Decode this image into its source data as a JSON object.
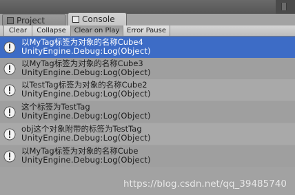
{
  "tabs": [
    {
      "label": "Project",
      "icon": "folder-icon"
    },
    {
      "label": "Console",
      "icon": "console-icon"
    }
  ],
  "toolbar": {
    "clear": "Clear",
    "collapse": "Collapse",
    "clear_on_play": "Clear on Play",
    "error_pause": "Error Pause"
  },
  "log_entries": [
    {
      "line1": "以MyTag标签为对象的名称Cube4",
      "line2": "UnityEngine.Debug:Log(Object)",
      "selected": true
    },
    {
      "line1": "以MyTag标签为对象的名称Cube3",
      "line2": "UnityEngine.Debug:Log(Object)",
      "selected": false
    },
    {
      "line1": "以TestTag标签为对象的名称Cube2",
      "line2": "UnityEngine.Debug:Log(Object)",
      "selected": false
    },
    {
      "line1": "这个标签为TestTag",
      "line2": "UnityEngine.Debug:Log(Object)",
      "selected": false
    },
    {
      "line1": "obj这个对象附带的标签为TestTag",
      "line2": "UnityEngine.Debug:Log(Object)",
      "selected": false
    },
    {
      "line1": "以MyTag标签为对象的名称Cube",
      "line2": "UnityEngine.Debug:Log(Object)",
      "selected": false
    }
  ],
  "watermark": "https://blog.csdn.net/qq_39485740",
  "colors": {
    "selected_row": "#3d6cc6",
    "background": "#a2a2a2",
    "titlebar": "#5f5f5f"
  }
}
